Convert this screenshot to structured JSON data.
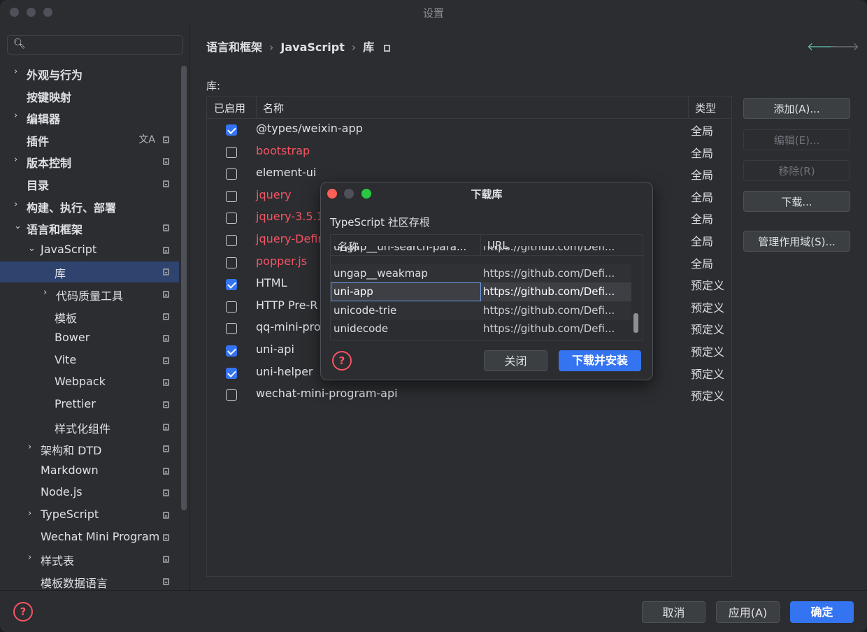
{
  "window": {
    "title": "设置"
  },
  "sidebar": {
    "items": [
      {
        "label": "外观与行为",
        "chevron": "›",
        "bold": true
      },
      {
        "label": "按键映射",
        "chevron": "",
        "bold": true
      },
      {
        "label": "编辑器",
        "chevron": "›",
        "bold": true
      },
      {
        "label": "插件",
        "chevron": "",
        "bold": true
      },
      {
        "label": "版本控制",
        "chevron": "›",
        "bold": true
      },
      {
        "label": "目录",
        "chevron": "",
        "bold": true
      },
      {
        "label": "构建、执行、部署",
        "chevron": "›",
        "bold": true
      },
      {
        "label": "语言和框架",
        "chevron": "⌄",
        "bold": true
      },
      {
        "label": "JavaScript",
        "chevron": "⌄",
        "bold": false
      },
      {
        "label": "库",
        "chevron": "",
        "bold": false
      },
      {
        "label": "代码质量工具",
        "chevron": "›",
        "bold": false
      },
      {
        "label": "模板",
        "chevron": "",
        "bold": false
      },
      {
        "label": "Bower",
        "chevron": "",
        "bold": false
      },
      {
        "label": "Vite",
        "chevron": "",
        "bold": false
      },
      {
        "label": "Webpack",
        "chevron": "",
        "bold": false
      },
      {
        "label": "Prettier",
        "chevron": "",
        "bold": false
      },
      {
        "label": "样式化组件",
        "chevron": "",
        "bold": false
      },
      {
        "label": "架构和 DTD",
        "chevron": "›",
        "bold": false
      },
      {
        "label": "Markdown",
        "chevron": "",
        "bold": false
      },
      {
        "label": "Node.js",
        "chevron": "",
        "bold": false
      },
      {
        "label": "TypeScript",
        "chevron": "›",
        "bold": false
      },
      {
        "label": "Wechat Mini Program",
        "chevron": "",
        "bold": false
      },
      {
        "label": "样式表",
        "chevron": "›",
        "bold": false
      },
      {
        "label": "模板数据语言",
        "chevron": "",
        "bold": false
      }
    ]
  },
  "breadcrumb": {
    "part1": "语言和框架",
    "part2": "JavaScript",
    "part3": "库",
    "sep": "›"
  },
  "main": {
    "libraries_label": "库:",
    "columns": {
      "enabled": "已启用",
      "name": "名称",
      "type": "类型"
    },
    "rows": [
      {
        "enabled": true,
        "name": "@types/weixin-app",
        "type": "全局",
        "red": false
      },
      {
        "enabled": false,
        "name": "bootstrap",
        "type": "全局",
        "red": true
      },
      {
        "enabled": false,
        "name": "element-ui",
        "type": "全局",
        "red": false
      },
      {
        "enabled": false,
        "name": "jquery",
        "type": "全局",
        "red": true
      },
      {
        "enabled": false,
        "name": "jquery-3.5.1",
        "type": "全局",
        "red": true
      },
      {
        "enabled": false,
        "name": "jquery-Defin",
        "type": "全局",
        "red": true
      },
      {
        "enabled": false,
        "name": "popper.js",
        "type": "全局",
        "red": true
      },
      {
        "enabled": true,
        "name": "HTML",
        "type": "预定义",
        "red": false
      },
      {
        "enabled": false,
        "name": "HTTP Pre-R",
        "type": "预定义",
        "red": false
      },
      {
        "enabled": false,
        "name": "qq-mini-pro",
        "type": "预定义",
        "red": false
      },
      {
        "enabled": true,
        "name": "uni-api",
        "type": "预定义",
        "red": false
      },
      {
        "enabled": true,
        "name": "uni-helper",
        "type": "预定义",
        "red": false
      },
      {
        "enabled": false,
        "name": "wechat-mini-program-api",
        "type": "预定义",
        "red": false
      }
    ]
  },
  "buttons": {
    "add": "添加(A)...",
    "edit": "编辑(E)...",
    "remove": "移除(R)",
    "download": "下载...",
    "manage_scopes": "管理作用域(S)..."
  },
  "footer": {
    "help": "?",
    "cancel": "取消",
    "apply": "应用(A)",
    "ok": "确定"
  },
  "dialog": {
    "title": "下载库",
    "subtitle": "TypeScript 社区存根",
    "columns": {
      "name": "名称",
      "url": "URL"
    },
    "rows": [
      {
        "name": "ungap__un-search-para...",
        "url": "https://github.com/Defi..."
      },
      {
        "name": "ungap__weakmap",
        "url": "https://github.com/Defi..."
      },
      {
        "name": "uni-app",
        "url": "https://github.com/Defi..."
      },
      {
        "name": "unicode-trie",
        "url": "https://github.com/Defi..."
      },
      {
        "name": "unidecode",
        "url": "https://github.com/Defi..."
      }
    ],
    "selected_index": 2,
    "close": "关闭",
    "download_install": "下载并安装",
    "help": "?"
  },
  "colors": {
    "accent": "#3574f0",
    "error": "#f75464",
    "selection": "#2e436e"
  }
}
